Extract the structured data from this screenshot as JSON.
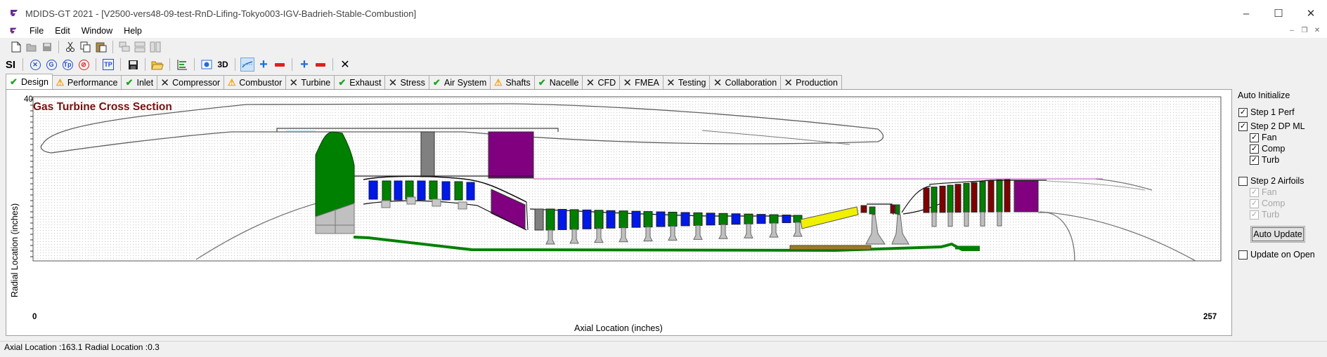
{
  "window": {
    "title": "MDIDS-GT 2021 - [V2500-vers48-09-test-RnD-Lifing-Tokyo003-IGV-Badrieh-Stable-Combustion]",
    "controls": [
      "–",
      "☐",
      "✕"
    ]
  },
  "menu": {
    "items": [
      "File",
      "Edit",
      "Window",
      "Help"
    ],
    "mdi_controls": [
      "–",
      "❐",
      "✕"
    ]
  },
  "toolbar2": {
    "si_label": "SI",
    "three_d_label": "3D"
  },
  "tabs": [
    {
      "label": "Design",
      "status": "check"
    },
    {
      "label": "Performance",
      "status": "warn"
    },
    {
      "label": "Inlet",
      "status": "check"
    },
    {
      "label": "Compressor",
      "status": "x"
    },
    {
      "label": "Combustor",
      "status": "warn"
    },
    {
      "label": "Turbine",
      "status": "x"
    },
    {
      "label": "Exhaust",
      "status": "check"
    },
    {
      "label": "Stress",
      "status": "x"
    },
    {
      "label": "Air System",
      "status": "check"
    },
    {
      "label": "Shafts",
      "status": "warn"
    },
    {
      "label": "Nacelle",
      "status": "check"
    },
    {
      "label": "CFD",
      "status": "x"
    },
    {
      "label": "FMEA",
      "status": "x"
    },
    {
      "label": "Testing",
      "status": "x"
    },
    {
      "label": "Collaboration",
      "status": "x"
    },
    {
      "label": "Production",
      "status": "x"
    }
  ],
  "plot": {
    "title": "Gas Turbine Cross Section",
    "xlabel": "Axial Location (inches)",
    "ylabel": "Radial Location (inches)",
    "y_max_label": "40",
    "x_min_label": "0",
    "x_max_label": "257"
  },
  "side": {
    "title": "Auto Initialize",
    "step1": {
      "label": "Step 1 Perf",
      "checked": true
    },
    "step2dp": {
      "label": "Step 2 DP ML",
      "checked": true
    },
    "dp_fan": {
      "label": "Fan",
      "checked": true
    },
    "dp_comp": {
      "label": "Comp",
      "checked": true
    },
    "dp_turb": {
      "label": "Turb",
      "checked": true
    },
    "step2air": {
      "label": "Step 2 Airfoils",
      "checked": false
    },
    "af_fan": {
      "label": "Fan",
      "checked": true
    },
    "af_comp": {
      "label": "Comp",
      "checked": true
    },
    "af_turb": {
      "label": "Turb",
      "checked": true
    },
    "auto_update_label": "Auto Update",
    "update_open": {
      "label": "Update on Open",
      "checked": false
    }
  },
  "status": {
    "text": "Axial Location :163.1 Radial Location :0.3"
  },
  "colors": {
    "title_red": "#7a1010",
    "fan_green": "#008000",
    "blade_blue": "#0018e8",
    "purple": "#800080",
    "yellow": "#f0f000",
    "shaft_brown": "#9c7a2c",
    "check_green": "#1fa61f",
    "warn_orange": "#f2a400"
  }
}
